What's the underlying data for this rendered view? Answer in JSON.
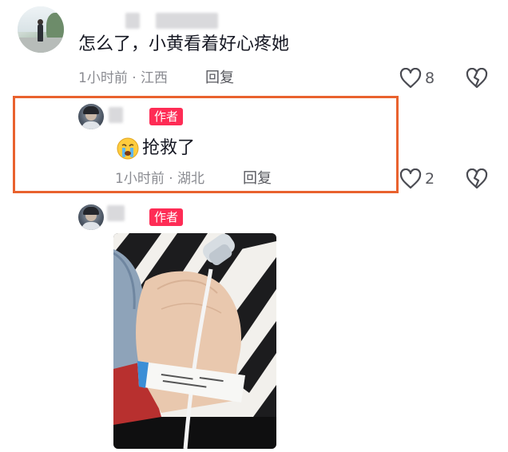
{
  "comment": {
    "text": "怎么了，小黄看着好心疼她",
    "time_location": "1小时前 · 江西",
    "reply_label": "回复",
    "like_count": "8"
  },
  "reply1": {
    "badge": "作者",
    "text": "抢救了",
    "emoji": "loudly-crying-face",
    "time_location": "1小时前 · 湖北",
    "reply_label": "回复",
    "like_count": "2"
  },
  "reply2": {
    "badge": "作者",
    "photo_description_icon": "hospital-wristband-photo"
  },
  "colors": {
    "highlight_border": "#e9622e",
    "author_badge": "#fe2c55",
    "meta_text": "#8a8b91"
  }
}
